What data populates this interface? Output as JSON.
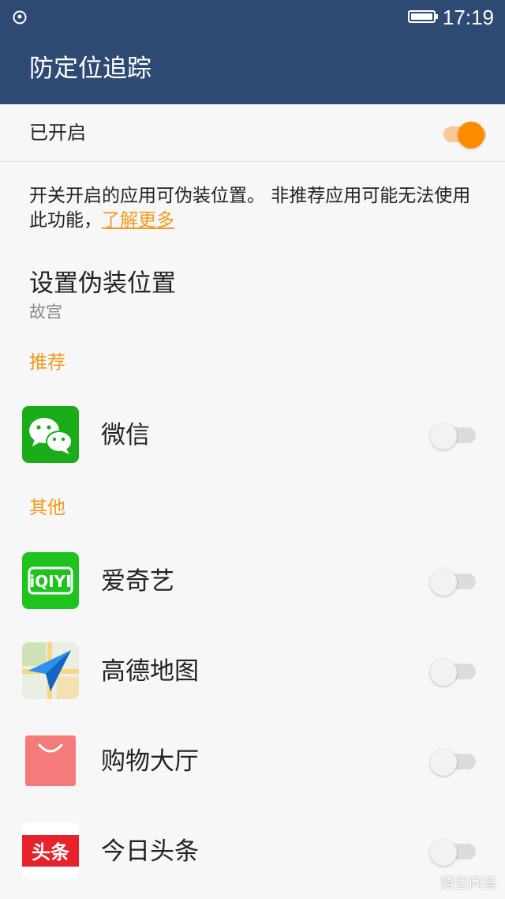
{
  "status_bar": {
    "time": "17:19",
    "icons": [
      "location-icon",
      "battery-icon"
    ]
  },
  "app_bar": {
    "title": "防定位追踪"
  },
  "master_switch": {
    "label": "已开启",
    "state": "on",
    "accent": "#fb8c00"
  },
  "description": {
    "text": "开关开启的应用可伪装位置。 非推荐应用可能无法使用此功能，",
    "link": "了解更多"
  },
  "fake_location": {
    "title": "设置伪装位置",
    "value": "故宫"
  },
  "sections": {
    "recommended": "推荐",
    "others": "其他"
  },
  "apps_recommended": [
    {
      "name": "微信",
      "icon": "wechat-icon",
      "enabled": false
    }
  ],
  "apps_others": [
    {
      "name": "爱奇艺",
      "icon": "iqiyi-icon",
      "enabled": false
    },
    {
      "name": "高德地图",
      "icon": "amap-icon",
      "enabled": false
    },
    {
      "name": "购物大厅",
      "icon": "shopping-bag-icon",
      "enabled": false
    },
    {
      "name": "今日头条",
      "icon": "toutiao-icon",
      "enabled": false
    }
  ],
  "colors": {
    "header": "#2f4a72",
    "accent": "#f29a1d",
    "background": "#f7f7f7"
  },
  "watermark": "悟空问答"
}
